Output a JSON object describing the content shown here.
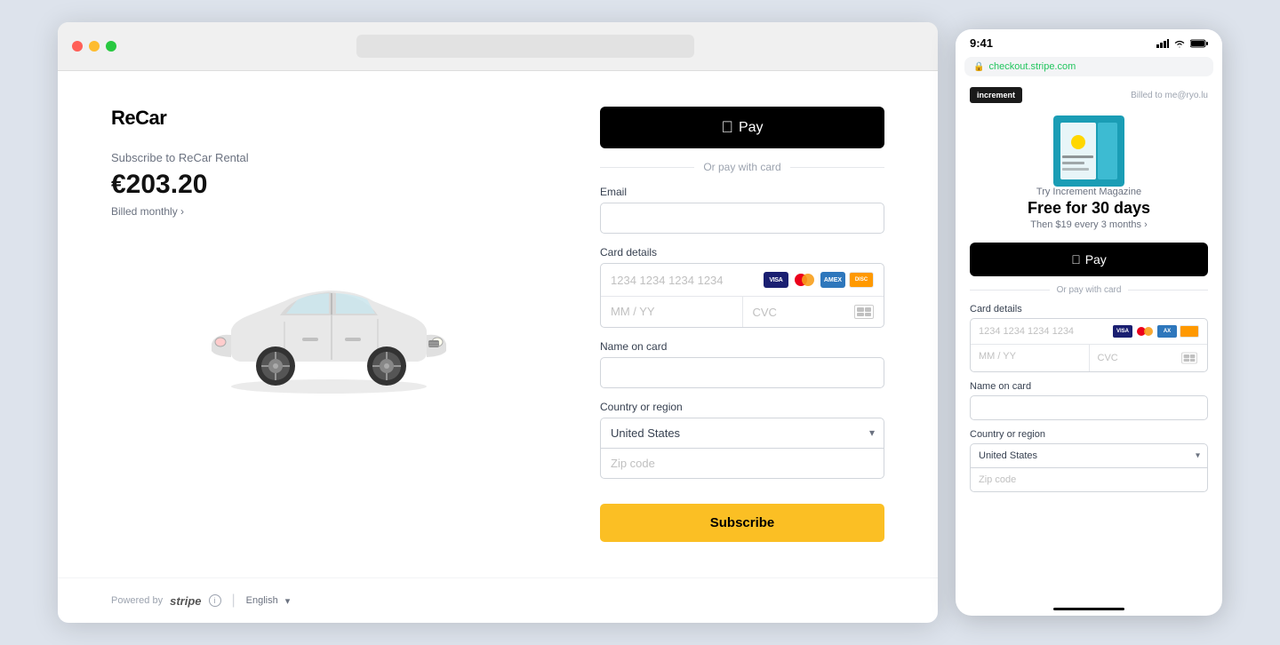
{
  "browser": {
    "dots": [
      "red",
      "yellow",
      "green"
    ],
    "address_bar": ""
  },
  "left_panel": {
    "brand_name": "ReCar",
    "subscribe_label": "Subscribe to ReCar Rental",
    "price": "€203.20",
    "billed_monthly": "Billed monthly"
  },
  "form": {
    "apple_pay_label": "Pay",
    "apple_pay_symbol": "",
    "divider_text": "Or pay with card",
    "email_label": "Email",
    "email_placeholder": "",
    "card_details_label": "Card details",
    "card_number_placeholder": "1234 1234 1234 1234",
    "expiry_placeholder": "MM / YY",
    "cvc_placeholder": "CVC",
    "name_label": "Name on card",
    "name_placeholder": "",
    "country_label": "Country or region",
    "country_value": "United States",
    "zip_placeholder": "Zip code",
    "subscribe_button": "Subscribe"
  },
  "footer": {
    "powered_by": "Powered by",
    "stripe": "stripe",
    "language": "English"
  },
  "mobile": {
    "status_bar": {
      "time": "9:41",
      "signal": "●●●",
      "wifi": "wifi",
      "battery": "battery"
    },
    "url": "checkout.stripe.com",
    "brand_logo": "increment",
    "billed_to": "Billed to me@ryo.lu",
    "product_label": "Try Increment Magazine",
    "product_heading": "Free for 30 days",
    "product_sub": "Then $19 every 3 months",
    "apple_pay_label": "Pay",
    "divider_text": "Or pay with card",
    "card_details_label": "Card details",
    "card_number_placeholder": "1234 1234 1234 1234",
    "expiry_placeholder": "MM / YY",
    "cvc_placeholder": "CVC",
    "name_label": "Name on card",
    "country_label": "Country or region",
    "country_value": "United States",
    "zip_placeholder": "Zip code"
  }
}
